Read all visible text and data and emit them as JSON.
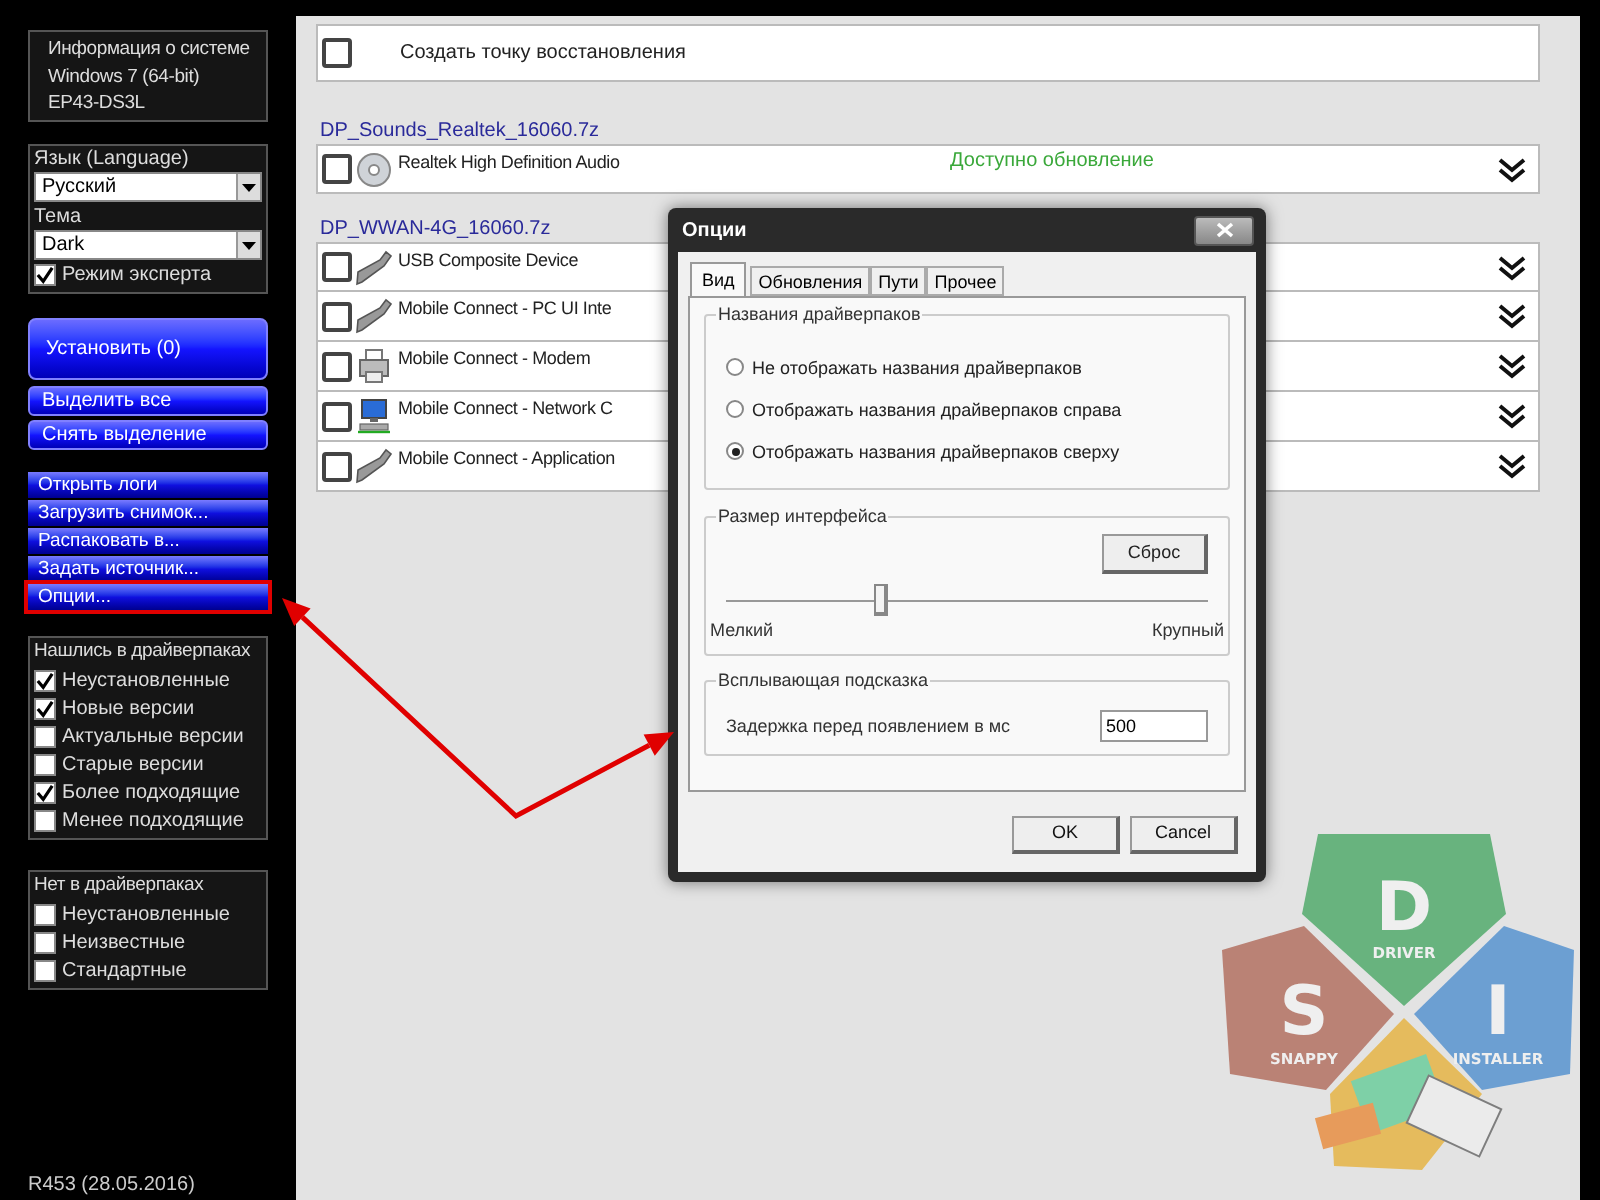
{
  "sidebar": {
    "system_info": [
      "Информация о системе",
      "Windows 7 (64-bit)",
      "EP43-DS3L"
    ],
    "language_label": "Язык (Language)",
    "language_value": "Русский",
    "theme_label": "Тема",
    "theme_value": "Dark",
    "expert_mode": {
      "label": "Режим эксперта",
      "checked": true
    },
    "install_button": "Установить (0)",
    "select_buttons": [
      "Выделить все",
      "Снять выделение"
    ],
    "menu": [
      {
        "label": "Открыть логи",
        "marked": false
      },
      {
        "label": "Загрузить снимок...",
        "marked": false
      },
      {
        "label": "Распаковать в...",
        "marked": false
      },
      {
        "label": "Задать источник...",
        "marked": false
      },
      {
        "label": "Опции...",
        "marked": true
      }
    ],
    "found_filter": {
      "title": "Нашлись в драйверпаках",
      "items": [
        {
          "label": "Неустановленные",
          "checked": true
        },
        {
          "label": "Новые версии",
          "checked": true
        },
        {
          "label": "Актуальные версии",
          "checked": false
        },
        {
          "label": "Старые версии",
          "checked": false
        },
        {
          "label": "Более подходящие",
          "checked": true
        },
        {
          "label": "Менее подходящие",
          "checked": false
        }
      ]
    },
    "missing_filter": {
      "title": "Нет в драйверпаках",
      "items": [
        {
          "label": "Неустановленные",
          "checked": false
        },
        {
          "label": "Неизвестные",
          "checked": false
        },
        {
          "label": "Стандартные",
          "checked": false
        }
      ]
    },
    "version": "R453 (28.05.2016)"
  },
  "main": {
    "restore_point": {
      "label": "Создать точку восстановления",
      "checked": false
    },
    "groups": [
      {
        "pack": "DP_Sounds_Realtek_16060.7z",
        "drivers": [
          {
            "name": "Realtek High Definition Audio",
            "kind": "disc",
            "status": "Доступно обновление",
            "checked": false
          }
        ]
      },
      {
        "pack": "DP_WWAN-4G_16060.7z",
        "drivers": [
          {
            "name": "USB Composite Device",
            "kind": "cable",
            "checked": false
          },
          {
            "name": "Mobile Connect - PC UI Inte",
            "kind": "cable",
            "checked": false
          },
          {
            "name": "Mobile Connect - Modem",
            "kind": "printer",
            "checked": false
          },
          {
            "name": "Mobile Connect - Network C",
            "kind": "computer",
            "checked": false
          },
          {
            "name": "Mobile Connect - Application",
            "kind": "cable",
            "checked": false
          }
        ]
      }
    ]
  },
  "dialog": {
    "title": "Опции",
    "tabs": [
      {
        "label": "Вид",
        "selected": true
      },
      {
        "label": "Обновления",
        "selected": false
      },
      {
        "label": "Пути",
        "selected": false
      },
      {
        "label": "Прочее",
        "selected": false
      }
    ],
    "pack_names": {
      "title": "Названия драйверпаков",
      "options": [
        {
          "label": "Не отображать названия драйверпаков",
          "selected": false
        },
        {
          "label": "Отображать названия драйверпаков справа",
          "selected": false
        },
        {
          "label": "Отображать названия драйверпаков сверху",
          "selected": true
        }
      ]
    },
    "interface_size": {
      "title": "Размер интерфейса",
      "reset_button": "Сброс",
      "level": 0.32,
      "min_label": "Мелкий",
      "max_label": "Крупный"
    },
    "tooltip": {
      "title": "Всплывающая подсказка",
      "delay_label": "Задержка перед появлением в мс",
      "delay_value": "500"
    },
    "buttons": [
      "OK",
      "Cancel"
    ]
  },
  "logo": [
    {
      "letter": "D",
      "word": "DRIVER"
    },
    {
      "letter": "S",
      "word": "SNAPPY"
    },
    {
      "letter": "I",
      "word": "INSTALLER"
    }
  ]
}
